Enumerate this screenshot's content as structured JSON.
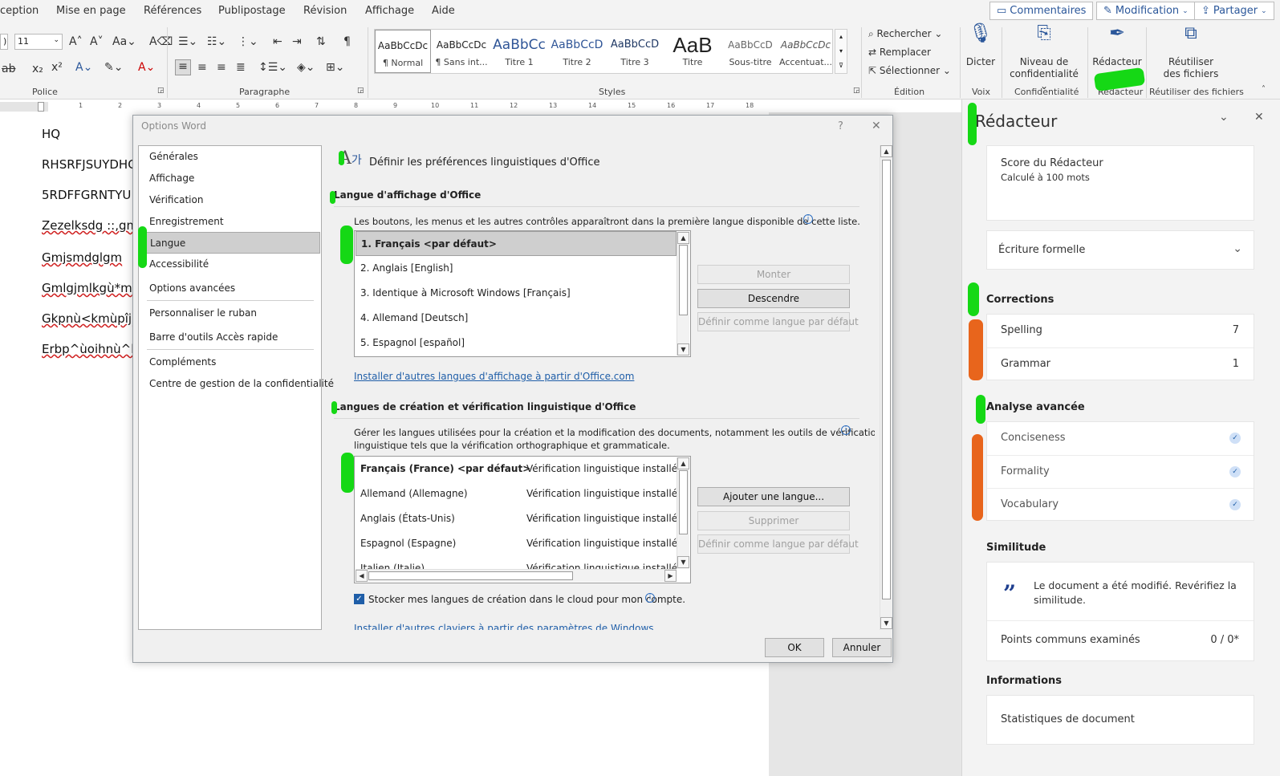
{
  "ribbon": {
    "tabs": [
      "ception",
      "Mise en page",
      "Références",
      "Publipostage",
      "Révision",
      "Affichage",
      "Aide"
    ],
    "header_buttons": {
      "comments": "Commentaires",
      "editing": "Modification",
      "share": "Partager"
    },
    "font": {
      "size": "11",
      "size_left_fragment": ")"
    },
    "groups": {
      "police": "Police",
      "paragraphe": "Paragraphe",
      "styles": "Styles",
      "edition": "Édition",
      "voix": "Voix",
      "confidentialite": "Confidentialité",
      "redacteur": "Rédacteur",
      "reutiliser": "Réutiliser des fichiers"
    },
    "styles": [
      {
        "preview": "AaBbCcDc",
        "name": "¶ Normal"
      },
      {
        "preview": "AaBbCcDc",
        "name": "¶ Sans int..."
      },
      {
        "preview": "AaBbCc",
        "name": "Titre 1"
      },
      {
        "preview": "AaBbCcD",
        "name": "Titre 2"
      },
      {
        "preview": "AaBbCcD",
        "name": "Titre 3"
      },
      {
        "preview": "AaB",
        "name": "Titre"
      },
      {
        "preview": "AaBbCcD",
        "name": "Sous-titre"
      },
      {
        "preview": "AaBbCcDc",
        "name": "Accentuat..."
      }
    ],
    "edition": {
      "find": "Rechercher",
      "replace": "Remplacer",
      "select": "Sélectionner"
    },
    "dictate": "Dicter",
    "sensitivity": {
      "line1": "Niveau de",
      "line2": "confidentialité"
    },
    "editor": "Rédacteur",
    "reuse": {
      "line1": "Réutiliser",
      "line2": "des fichiers"
    }
  },
  "ruler_numbers": [
    "1",
    "2",
    "3",
    "4",
    "5",
    "6",
    "7",
    "8",
    "9",
    "10",
    "11",
    "12",
    "13",
    "14",
    "15",
    "16",
    "17",
    "18"
  ],
  "document": {
    "lines": [
      "HQ",
      "RHSRFJSUYDHG",
      "5RDFFGRNTYU",
      "Zezelksdg ::,gm",
      "Gmjsmdglgm",
      "Gmlgjmlkgù*m",
      "Gkpnù<kmùpîj",
      "Erbp^ùoihnù^l"
    ]
  },
  "dialog": {
    "title": "Options Word",
    "help": "?",
    "close": "✕",
    "categories": [
      "Générales",
      "Affichage",
      "Vérification",
      "Enregistrement",
      "Langue",
      "Accessibilité",
      "Options avancées",
      "Personnaliser le ruban",
      "Barre d'outils Accès rapide",
      "Compléments",
      "Centre de gestion de la confidentialité"
    ],
    "heading": "Définir les préférences linguistiques d'Office",
    "display_section": {
      "title": "Langue d'affichage d'Office",
      "desc": "Les boutons, les menus et les autres contrôles apparaîtront dans la première langue disponible de cette liste.",
      "languages": [
        "1.    Français <par défaut>",
        "2.    Anglais [English]",
        "3.    Identique à Microsoft Windows [Français]",
        "4.    Allemand [Deutsch]",
        "5.    Espagnol [español]"
      ],
      "buttons": {
        "up": "Monter",
        "down": "Descendre",
        "default": "Définir comme langue par défaut"
      },
      "link": "Installer d'autres langues d'affichage à partir d'Office.com"
    },
    "authoring_section": {
      "title": "Langues de création et vérification linguistique d'Office",
      "desc1": "Gérer les langues utilisées pour la création et la modification des documents, notamment les outils de vérification",
      "desc2": "linguistique tels que la vérification orthographique et grammaticale.",
      "languages": [
        {
          "name": "Français (France) <par défaut>",
          "status": "Vérification linguistique installée"
        },
        {
          "name": "Allemand (Allemagne)",
          "status": "Vérification linguistique installée"
        },
        {
          "name": "Anglais (États-Unis)",
          "status": "Vérification linguistique installée"
        },
        {
          "name": "Espagnol (Espagne)",
          "status": "Vérification linguistique installée"
        },
        {
          "name": "Italien (Italie)",
          "status": "Vérification linguistique installée"
        }
      ],
      "buttons": {
        "add": "Ajouter une langue...",
        "remove": "Supprimer",
        "default": "Définir comme langue par défaut"
      },
      "cloud_checkbox": "Stocker mes langues de création dans le cloud pour mon compte.",
      "link": "Installer d'autres claviers à partir des paramètres de Windows"
    },
    "ok": "OK",
    "cancel": "Annuler"
  },
  "pane": {
    "title": "Rédacteur",
    "score_title": "Score du Rédacteur",
    "score_sub": "Calculé à 100 mots",
    "style_select": "Écriture formelle",
    "corrections": "Corrections",
    "spelling": "Spelling",
    "spelling_count": "7",
    "grammar": "Grammar",
    "grammar_count": "1",
    "advanced": "Analyse avancée",
    "conciseness": "Conciseness",
    "formality": "Formality",
    "vocabulary": "Vocabulary",
    "similarity": "Similitude",
    "similarity_msg": "Le document a été modifié. Revérifiez la similitude.",
    "points": "Points communs examinés",
    "points_val": "0 / 0*",
    "informations": "Informations",
    "stats": "Statistiques de document"
  },
  "colors": {
    "accent": "#2b579a",
    "highlight_green": "#15d815",
    "highlight_orange": "#e8651c"
  }
}
